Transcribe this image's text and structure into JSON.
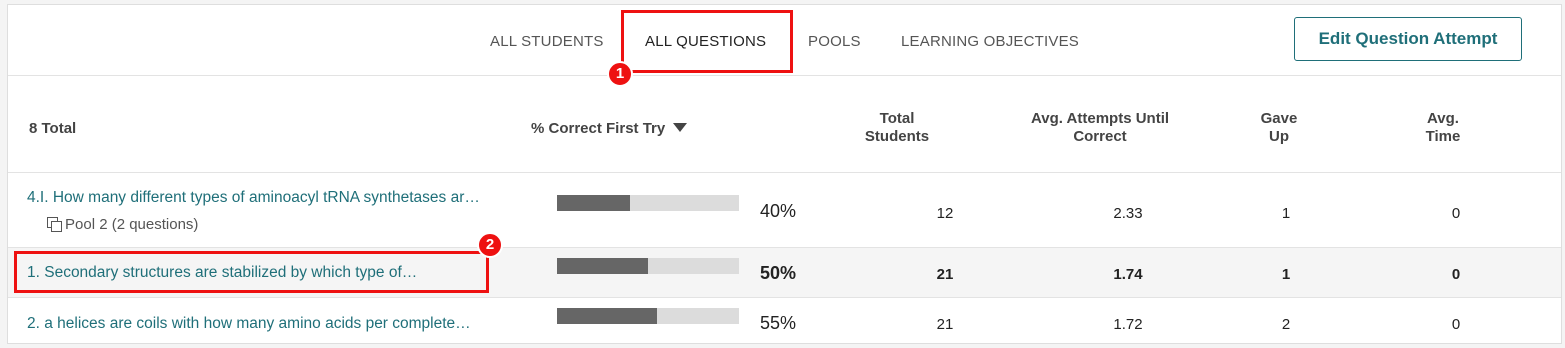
{
  "tabs": [
    {
      "label": "ALL STUDENTS"
    },
    {
      "label": "ALL QUESTIONS",
      "active": true
    },
    {
      "label": "POOLS"
    },
    {
      "label": "LEARNING OBJECTIVES"
    }
  ],
  "edit_button": "Edit Question Attempt",
  "header": {
    "total": "8 Total",
    "correct_first_try": "% Correct First Try",
    "total_students": [
      "Total",
      "Students"
    ],
    "avg_attempts": [
      "Avg. Attempts Until",
      "Correct"
    ],
    "gave_up": [
      "Gave",
      "Up"
    ],
    "avg_time": [
      "Avg.",
      "Time"
    ]
  },
  "rows": [
    {
      "question": "4.I. How many different types of aminoacyl tRNA synthetases ar…",
      "pool": "Pool 2 (2 questions)",
      "percent_value": 40,
      "percent": "40%",
      "students": "12",
      "attempts": "2.33",
      "gave_up": "1",
      "time": "0"
    },
    {
      "question": "1. Secondary structures are stabilized by which type of…",
      "percent_value": 50,
      "percent": "50%",
      "students": "21",
      "attempts": "1.74",
      "gave_up": "1",
      "time": "0"
    },
    {
      "question": "2. a helices are coils with how many amino acids per complete…",
      "percent_value": 55,
      "percent": "55%",
      "students": "21",
      "attempts": "1.72",
      "gave_up": "2",
      "time": "0"
    }
  ],
  "annotations": [
    "1",
    "2"
  ],
  "colors": {
    "accent": "#1f6f79",
    "annotation": "#e11111",
    "bar_fill": "#666666",
    "bar_track": "#dcdcdc"
  }
}
